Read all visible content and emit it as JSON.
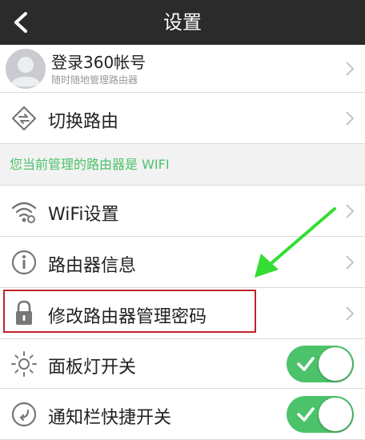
{
  "header": {
    "title": "设置",
    "back_icon": "chevron-left-icon"
  },
  "account": {
    "title": "登录360帐号",
    "subtitle": "随时随地管理路由器",
    "avatar_icon": "user-avatar-icon"
  },
  "switch_router": {
    "label": "切换路由",
    "icon": "switch-router-icon"
  },
  "section_header": "您当前管理的路由器是 WIFI",
  "menu": [
    {
      "label": "WiFi设置",
      "icon": "wifi-icon"
    },
    {
      "label": "路由器信息",
      "icon": "info-icon"
    },
    {
      "label": "修改路由器管理密码",
      "icon": "lock-icon"
    }
  ],
  "toggles": [
    {
      "label": "面板灯开关",
      "icon": "sun-icon",
      "on": true
    },
    {
      "label": "通知栏快捷开关",
      "icon": "notification-shortcut-icon",
      "on": true
    }
  ],
  "colors": {
    "header_bg": "#2b2b2b",
    "accent_green": "#4cc36a",
    "highlight_red": "#c0232b",
    "arrow_green": "#33dd33"
  }
}
